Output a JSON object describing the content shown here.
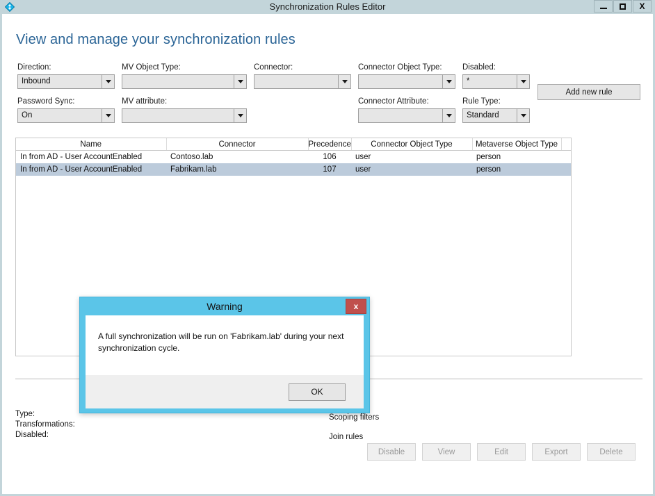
{
  "window": {
    "title": "Synchronization Rules Editor",
    "icon": "sync-diamond-icon",
    "minimize_label": "–",
    "maximize_label": "□",
    "close_label": "X",
    "titlebar_color": "#c3d5da"
  },
  "page": {
    "heading": "View and manage your synchronization rules",
    "heading_color": "#2a6496"
  },
  "filters": {
    "direction": {
      "label": "Direction:",
      "value": "Inbound"
    },
    "password_sync": {
      "label": "Password Sync:",
      "value": "On"
    },
    "mv_object_type": {
      "label": "MV Object Type:",
      "value": ""
    },
    "mv_attribute": {
      "label": "MV attribute:",
      "value": ""
    },
    "connector": {
      "label": "Connector:",
      "value": ""
    },
    "connector_object_type": {
      "label": "Connector Object Type:",
      "value": ""
    },
    "connector_attribute": {
      "label": "Connector Attribute:",
      "value": ""
    },
    "disabled": {
      "label": "Disabled:",
      "value": "*"
    },
    "rule_type": {
      "label": "Rule Type:",
      "value": "Standard"
    },
    "add_new_rule_label": "Add new rule"
  },
  "rules_table": {
    "columns": [
      "Name",
      "Connector",
      "Precedence",
      "Connector Object Type",
      "Metaverse Object Type"
    ],
    "rows": [
      {
        "name": "In from AD - User AccountEnabled",
        "connector": "Contoso.lab",
        "precedence": "106",
        "connector_object_type": "user",
        "metaverse_object_type": "person",
        "selected": false
      },
      {
        "name": "In from AD - User AccountEnabled",
        "connector": "Fabrikam.lab",
        "precedence": "107",
        "connector_object_type": "user",
        "metaverse_object_type": "person",
        "selected": true
      }
    ],
    "selected_row_color": "#bccbdb"
  },
  "details": {
    "type_label": "Type:",
    "transformations_label": "Transformations:",
    "disabled_label": "Disabled:",
    "scoping_filters_label": "Scoping filters",
    "join_rules_label": "Join rules"
  },
  "actions": {
    "buttons": [
      "Disable",
      "View",
      "Edit",
      "Export",
      "Delete"
    ]
  },
  "dialog": {
    "title": "Warning",
    "close_label": "x",
    "message": "A full synchronization will be run on 'Fabrikam.lab' during your next synchronization cycle.",
    "ok_label": "OK",
    "border_color": "#5bc5e8",
    "close_color": "#c0504d"
  }
}
